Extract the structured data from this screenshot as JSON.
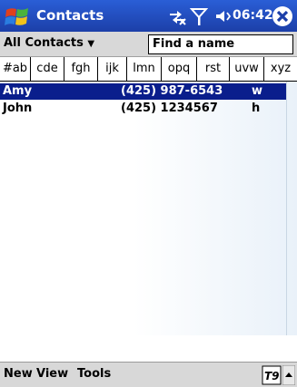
{
  "titlebar": {
    "app_title": "Contacts",
    "time": "06:42"
  },
  "filter": {
    "category": "All Contacts",
    "find_placeholder": "Find a name"
  },
  "tabs": [
    "#ab",
    "cde",
    "fgh",
    "ijk",
    "lmn",
    "opq",
    "rst",
    "uvw",
    "xyz"
  ],
  "contacts": [
    {
      "name": "Amy",
      "phone": "(425) 987-6543",
      "type": "w",
      "selected": true
    },
    {
      "name": "John",
      "phone": "(425) 1234567",
      "type": "h",
      "selected": false
    }
  ],
  "menubar": {
    "new": "New",
    "view": "View",
    "tools": "Tools"
  },
  "colors": {
    "titlebar": "#1c3fa8",
    "selection": "#0a1e8c",
    "chrome": "#d8d8d8"
  },
  "icons": [
    "windows-start-icon",
    "connectivity-icon",
    "signal-icon",
    "speaker-icon",
    "close-icon",
    "input-panel-icon",
    "input-arrow-icon"
  ]
}
